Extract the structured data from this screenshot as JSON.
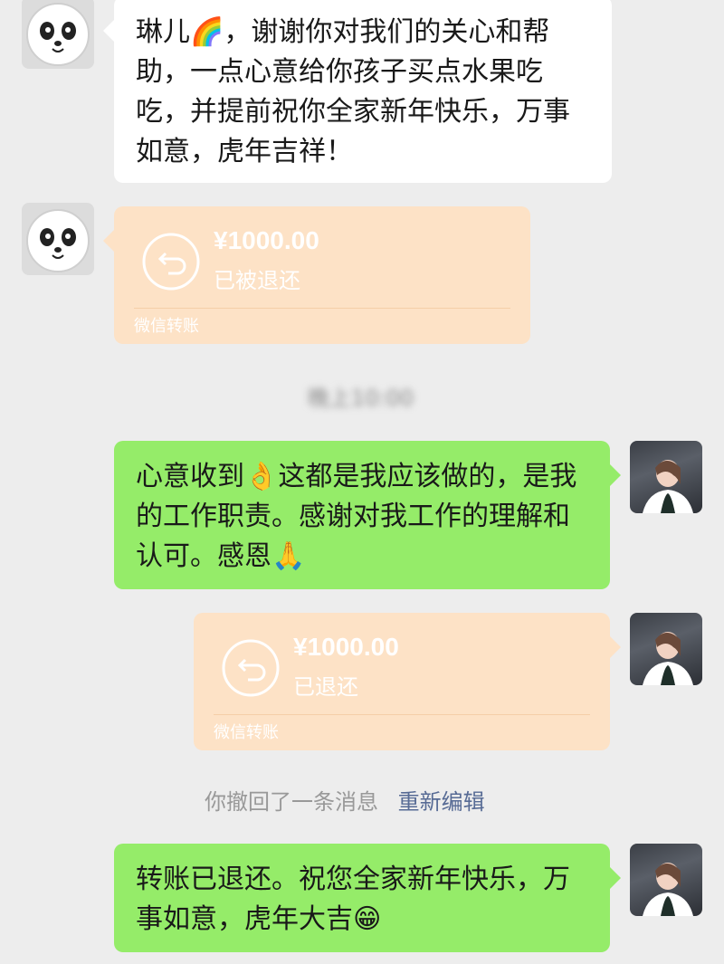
{
  "messages": {
    "m1": {
      "text": "琳儿🌈，谢谢你对我们的关心和帮助，一点心意给你孩子买点水果吃吃，并提前祝你全家新年快乐，万事如意，虎年吉祥！"
    },
    "t1": {
      "amount": "¥1000.00",
      "status": "已被退还",
      "footer": "微信转账"
    },
    "s1": {
      "text": "晚上10:00"
    },
    "m2": {
      "text": "心意收到👌这都是我应该做的，是我的工作职责。感谢对我工作的理解和认可。感恩🙏"
    },
    "t2": {
      "amount": "¥1000.00",
      "status": "已退还",
      "footer": "微信转账"
    },
    "s2": {
      "text": "你撤回了一条消息",
      "link": "重新编辑"
    },
    "m3": {
      "text": "转账已退还。祝您全家新年快乐，万事如意，虎年大吉😁"
    }
  },
  "colors": {
    "background": "#ededed",
    "sent_bubble": "#95ec69",
    "received_bubble": "#ffffff",
    "transfer_card": "#fde2c6",
    "link": "#576b95"
  }
}
